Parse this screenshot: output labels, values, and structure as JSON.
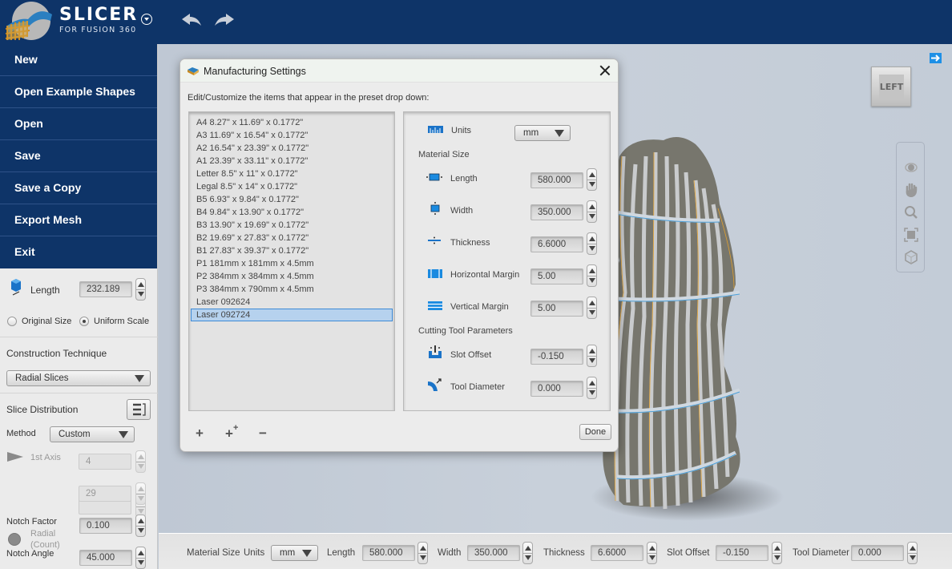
{
  "app": {
    "title": "SLICER",
    "subtitle": "FOR FUSION 360"
  },
  "toolbar": {
    "undo_label": "undo",
    "redo_label": "redo"
  },
  "file_menu": {
    "items": [
      {
        "label": "New"
      },
      {
        "label": "Open Example Shapes"
      },
      {
        "label": "Open"
      },
      {
        "label": "Save"
      },
      {
        "label": "Save a Copy"
      },
      {
        "label": "Export Mesh"
      },
      {
        "label": "Exit"
      }
    ]
  },
  "left_panel": {
    "length_label": "Length",
    "length_value": "232.189",
    "size_options": [
      {
        "label": "Original Size",
        "selected": false
      },
      {
        "label": "Uniform Scale",
        "selected": true
      }
    ],
    "construction_technique": {
      "heading": "Construction Technique",
      "value": "Radial Slices"
    },
    "slice_distribution": {
      "heading": "Slice Distribution",
      "method_label": "Method",
      "method_value": "Custom",
      "first_axis_label": "1st Axis",
      "first_axis_value": "4",
      "radial_label_1": "Radial",
      "radial_label_2": "(Count)",
      "radial_value": "29",
      "notch_factor_label": "Notch Factor",
      "notch_factor_value": "0.100",
      "notch_angle_label": "Notch Angle",
      "notch_angle_value": "45.000"
    }
  },
  "viewport": {
    "view_cube_label": "LEFT"
  },
  "dialog": {
    "title": "Manufacturing Settings",
    "description": "Edit/Customize the items that appear in the preset drop down:",
    "presets": [
      "A4 8.27\" x 11.69\" x 0.1772\"",
      "A3 11.69\" x 16.54\" x 0.1772\"",
      "A2 16.54\" x 23.39\" x 0.1772\"",
      "A1 23.39\" x 33.11\" x 0.1772\"",
      "Letter 8.5\" x 11\" x 0.1772\"",
      "Legal 8.5\" x 14\" x 0.1772\"",
      "B5 6.93\" x 9.84\" x 0.1772\"",
      "B4 9.84\" x 13.90\" x 0.1772\"",
      "B3 13.90\" x 19.69\" x 0.1772\"",
      "B2 19.69\" x 27.83\" x 0.1772\"",
      "B1 27.83\" x 39.37\" x 0.1772\"",
      "P1 181mm x 181mm x 4.5mm",
      "P2 384mm x 384mm x 4.5mm",
      "P3 384mm x 790mm x 4.5mm",
      "Laser 092624",
      "Laser 092724"
    ],
    "selected_preset": "Laser 092724",
    "units_label": "Units",
    "units_value": "mm",
    "material_size_heading": "Material Size",
    "length_label": "Length",
    "length_value": "580.000",
    "width_label": "Width",
    "width_value": "350.000",
    "thickness_label": "Thickness",
    "thickness_value": "6.6000",
    "hmargin_label": "Horizontal Margin",
    "hmargin_value": "5.00",
    "vmargin_label": "Vertical Margin",
    "vmargin_value": "5.00",
    "cutting_heading": "Cutting Tool Parameters",
    "slot_offset_label": "Slot Offset",
    "slot_offset_value": "-0.150",
    "tool_diameter_label": "Tool Diameter",
    "tool_diameter_value": "0.000",
    "add_label": "+",
    "duplicate_label": "++",
    "remove_label": "−",
    "done_label": "Done"
  },
  "statusbar": {
    "material_size_label": "Material Size",
    "units_label": "Units",
    "units_value": "mm",
    "length_label": "Length",
    "length_value": "580.000",
    "width_label": "Width",
    "width_value": "350.000",
    "thickness_label": "Thickness",
    "thickness_value": "6.6000",
    "slot_offset_label": "Slot Offset",
    "slot_offset_value": "-0.150",
    "tool_diameter_label": "Tool Diameter",
    "tool_diameter_value": "0.000"
  },
  "colors": {
    "brand": "#0e3468",
    "accent": "#1e90e6",
    "slice_edge": "#e0a030"
  }
}
